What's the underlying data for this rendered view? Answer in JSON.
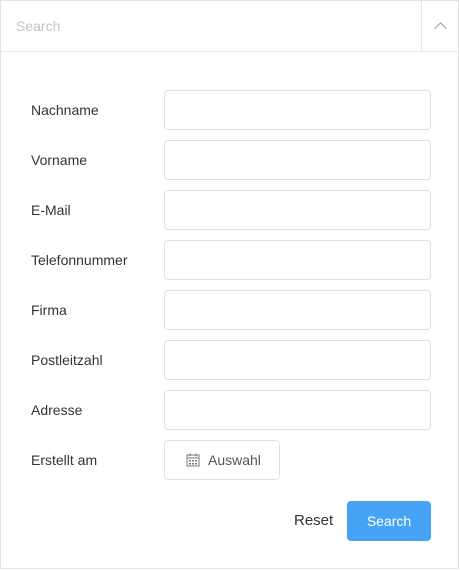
{
  "header": {
    "search_placeholder": "Search",
    "toggle_icon": "chevron-up-icon"
  },
  "form": {
    "fields": [
      {
        "label": "Nachname",
        "value": ""
      },
      {
        "label": "Vorname",
        "value": ""
      },
      {
        "label": "E-Mail",
        "value": ""
      },
      {
        "label": "Telefonnummer",
        "value": ""
      },
      {
        "label": "Firma",
        "value": ""
      },
      {
        "label": "Postleitzahl",
        "value": ""
      },
      {
        "label": "Adresse",
        "value": ""
      }
    ],
    "created": {
      "label": "Erstellt am",
      "button_label": "Auswahl",
      "icon": "calendar-icon"
    }
  },
  "actions": {
    "reset_label": "Reset",
    "search_label": "Search"
  },
  "colors": {
    "primary": "#47a3f5",
    "border": "#e0e0e0",
    "placeholder": "#c3c3c3"
  }
}
